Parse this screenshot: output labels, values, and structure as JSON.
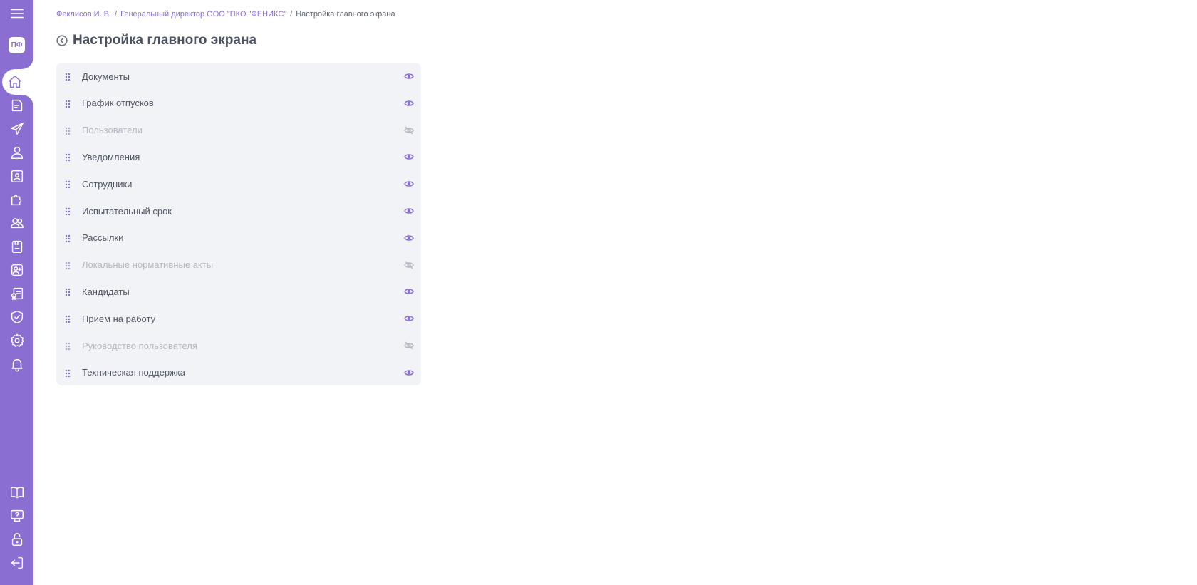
{
  "colors": {
    "accent": "#8a6ed1",
    "text": "#4f5664",
    "muted": "#b4b8c2",
    "panel_bg": "#f2f3f7"
  },
  "sidebar": {
    "logo_text": "ПФ",
    "top_icons": [
      "menu-icon",
      "home-icon",
      "document-icon",
      "send-icon",
      "user-icon",
      "badge-icon",
      "puzzle-icon",
      "team-icon",
      "clipboard-icon",
      "contact-add-icon",
      "certificate-icon",
      "shield-check-icon",
      "gear-icon",
      "bell-icon"
    ],
    "bottom_icons": [
      "book-icon",
      "support-icon",
      "lock-icon",
      "logout-icon"
    ]
  },
  "breadcrumb": {
    "items": [
      "Феклисов И. В.",
      "Генеральный директор ООО \"ПКО \"ФЕНИКС\"",
      "Настройка главного экрана"
    ],
    "separator": "/"
  },
  "page": {
    "title": "Настройка главного экрана"
  },
  "widgets": [
    {
      "label": "Документы",
      "visible": true
    },
    {
      "label": "График отпусков",
      "visible": true
    },
    {
      "label": "Пользователи",
      "visible": false
    },
    {
      "label": "Уведомления",
      "visible": true
    },
    {
      "label": "Сотрудники",
      "visible": true
    },
    {
      "label": "Испытательный срок",
      "visible": true
    },
    {
      "label": "Рассылки",
      "visible": true
    },
    {
      "label": "Локальные нормативные акты",
      "visible": false
    },
    {
      "label": "Кандидаты",
      "visible": true
    },
    {
      "label": "Прием на работу",
      "visible": true
    },
    {
      "label": "Руководство пользователя",
      "visible": false
    },
    {
      "label": "Техническая поддержка",
      "visible": true
    }
  ]
}
